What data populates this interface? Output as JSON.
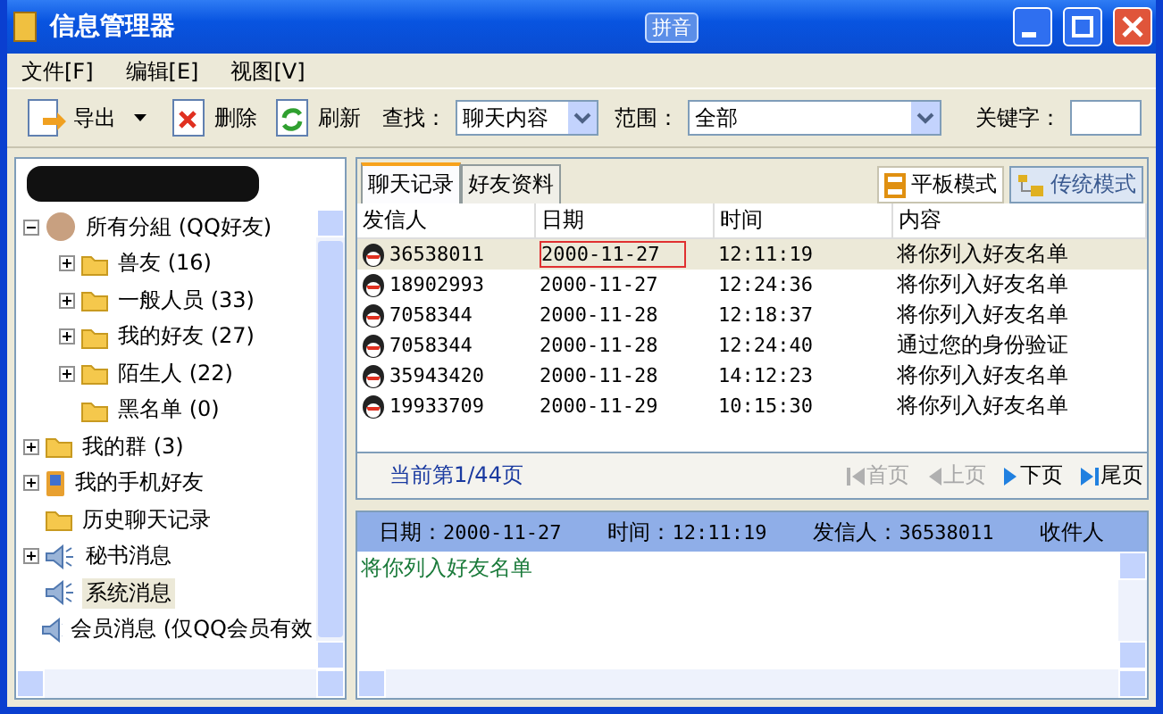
{
  "window": {
    "title": "信息管理器",
    "ime_indicator": "拼音"
  },
  "menu": [
    "文件[F]",
    "编辑[E]",
    "视图[V]"
  ],
  "toolbar": {
    "buttons": [
      {
        "label": "导出",
        "kind": "export",
        "dropdown": true
      },
      {
        "label": "删除",
        "kind": "delete",
        "dropdown": false
      },
      {
        "label": "刷新",
        "kind": "refresh",
        "dropdown": false
      }
    ],
    "find": {
      "label": "查找：",
      "value": "聊天内容"
    },
    "scope": {
      "label": "范围：",
      "value": "全部"
    },
    "keyword": {
      "label": "关键字："
    }
  },
  "tree": [
    {
      "label": "所有分組 (QQ好友)",
      "kind": "avatar",
      "expanded": true,
      "selected": false,
      "children": [
        {
          "label": "兽友 (16)",
          "kind": "folder",
          "expanded": false,
          "selected": false
        },
        {
          "label": "一般人员 (33)",
          "kind": "folder",
          "expanded": false,
          "selected": false
        },
        {
          "label": "我的好友 (27)",
          "kind": "folder",
          "expanded": false,
          "selected": false
        },
        {
          "label": "陌生人 (22)",
          "kind": "folder",
          "expanded": false,
          "selected": false
        },
        {
          "label": "黑名单 (0)",
          "kind": "folder",
          "selected": false
        }
      ]
    },
    {
      "label": "我的群 (3)",
      "kind": "folder",
      "expanded": false,
      "selected": false
    },
    {
      "label": "我的手机好友",
      "kind": "phone",
      "expanded": false,
      "selected": false
    },
    {
      "label": "历史聊天记录",
      "kind": "folder",
      "selected": false
    },
    {
      "label": "秘书消息",
      "kind": "speaker",
      "expanded": false,
      "selected": false
    },
    {
      "label": "系统消息",
      "kind": "speaker",
      "selected": true
    },
    {
      "label": "会员消息 (仅QQ会员有效",
      "kind": "speaker",
      "selected": false
    }
  ],
  "tabs": [
    {
      "label": "聊天记录",
      "selected": true
    },
    {
      "label": "好友资料",
      "selected": false
    }
  ],
  "modes": [
    {
      "label": "平板模式",
      "kind": "flat",
      "selected": false
    },
    {
      "label": "传统模式",
      "kind": "tree",
      "selected": true
    }
  ],
  "table": {
    "columns": [
      "发信人",
      "日期",
      "时间",
      "内容"
    ],
    "rows": [
      {
        "cells": [
          "36538011",
          "2000-11-27",
          "12:11:19",
          "将你列入好友名单"
        ],
        "selected": true
      },
      {
        "cells": [
          "18902993",
          "2000-11-27",
          "12:24:36",
          "将你列入好友名单"
        ],
        "selected": false
      },
      {
        "cells": [
          "7058344",
          "2000-11-28",
          "12:18:37",
          "将你列入好友名单"
        ],
        "selected": false
      },
      {
        "cells": [
          "7058344",
          "2000-11-28",
          "12:24:40",
          "通过您的身份验证"
        ],
        "selected": false
      },
      {
        "cells": [
          "35943420",
          "2000-11-28",
          "14:12:23",
          "将你列入好友名单"
        ],
        "selected": false
      },
      {
        "cells": [
          "19933709",
          "2000-11-29",
          "10:15:30",
          "将你列入好友名单"
        ],
        "selected": false
      }
    ]
  },
  "pager": {
    "status": "当前第1/44页",
    "buttons": [
      {
        "label": "首页",
        "kind": "first",
        "disabled": true
      },
      {
        "label": "上页",
        "kind": "prev",
        "disabled": true
      },
      {
        "label": "下页",
        "kind": "next",
        "disabled": false
      },
      {
        "label": "尾页",
        "kind": "last",
        "disabled": false
      }
    ]
  },
  "detail": {
    "fields": [
      {
        "label": "日期：",
        "value": "2000-11-27"
      },
      {
        "label": "时间：",
        "value": "12:11:19"
      },
      {
        "label": "发信人：",
        "value": "36538011"
      },
      {
        "label": "收件人"
      }
    ],
    "message": "将你列入好友名单"
  }
}
